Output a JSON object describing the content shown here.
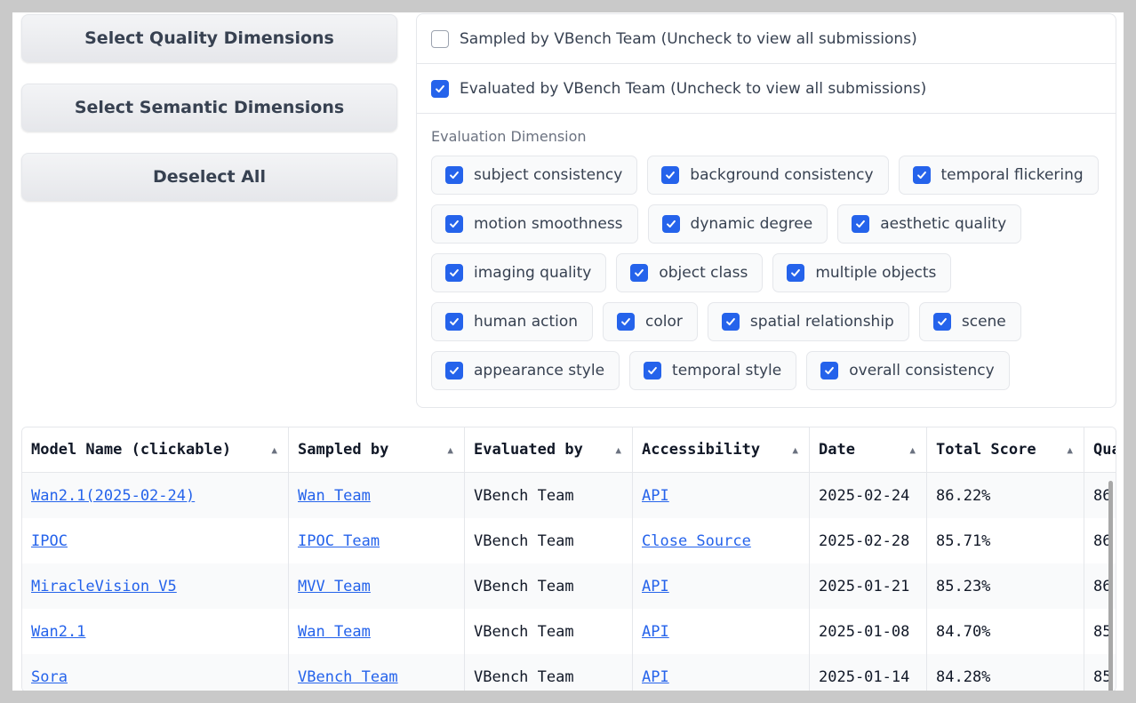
{
  "buttons": {
    "quality": "Select Quality Dimensions",
    "semantic": "Select Semantic Dimensions",
    "deselect": "Deselect All"
  },
  "filters": {
    "sampled": {
      "label": "Sampled by VBench Team (Uncheck to view all submissions)",
      "checked": false
    },
    "evaluated": {
      "label": "Evaluated by VBench Team (Uncheck to view all submissions)",
      "checked": true
    }
  },
  "dimensions": {
    "label": "Evaluation Dimension",
    "items": [
      {
        "label": "subject consistency",
        "checked": true
      },
      {
        "label": "background consistency",
        "checked": true
      },
      {
        "label": "temporal flickering",
        "checked": true
      },
      {
        "label": "motion smoothness",
        "checked": true
      },
      {
        "label": "dynamic degree",
        "checked": true
      },
      {
        "label": "aesthetic quality",
        "checked": true
      },
      {
        "label": "imaging quality",
        "checked": true
      },
      {
        "label": "object class",
        "checked": true
      },
      {
        "label": "multiple objects",
        "checked": true
      },
      {
        "label": "human action",
        "checked": true
      },
      {
        "label": "color",
        "checked": true
      },
      {
        "label": "spatial relationship",
        "checked": true
      },
      {
        "label": "scene",
        "checked": true
      },
      {
        "label": "appearance style",
        "checked": true
      },
      {
        "label": "temporal style",
        "checked": true
      },
      {
        "label": "overall consistency",
        "checked": true
      }
    ]
  },
  "table": {
    "sort_icon": "▲",
    "headers": [
      "Model Name (clickable)",
      "Sampled by",
      "Evaluated by",
      "Accessibility",
      "Date",
      "Total Score",
      "Qua"
    ],
    "rows": [
      [
        "Wan2.1(2025-02-24)",
        "Wan Team",
        "VBench Team",
        "API",
        "2025-02-24",
        "86.22%",
        "86"
      ],
      [
        "IPOC",
        "IPOC Team",
        "VBench Team",
        "Close Source",
        "2025-02-28",
        "85.71%",
        "86"
      ],
      [
        "MiracleVision V5",
        "MVV Team",
        "VBench Team",
        "API",
        "2025-01-21",
        "85.23%",
        "86"
      ],
      [
        "Wan2.1",
        "Wan Team",
        "VBench Team",
        "API",
        "2025-01-08",
        "84.70%",
        "85"
      ],
      [
        "Sora",
        "VBench Team",
        "VBench Team",
        "API",
        "2025-01-14",
        "84.28%",
        "85"
      ]
    ],
    "link_columns": [
      0,
      1,
      3
    ]
  },
  "colors": {
    "accent": "#2563eb",
    "page": "#ffffff",
    "frame": "#c9c9c9"
  }
}
